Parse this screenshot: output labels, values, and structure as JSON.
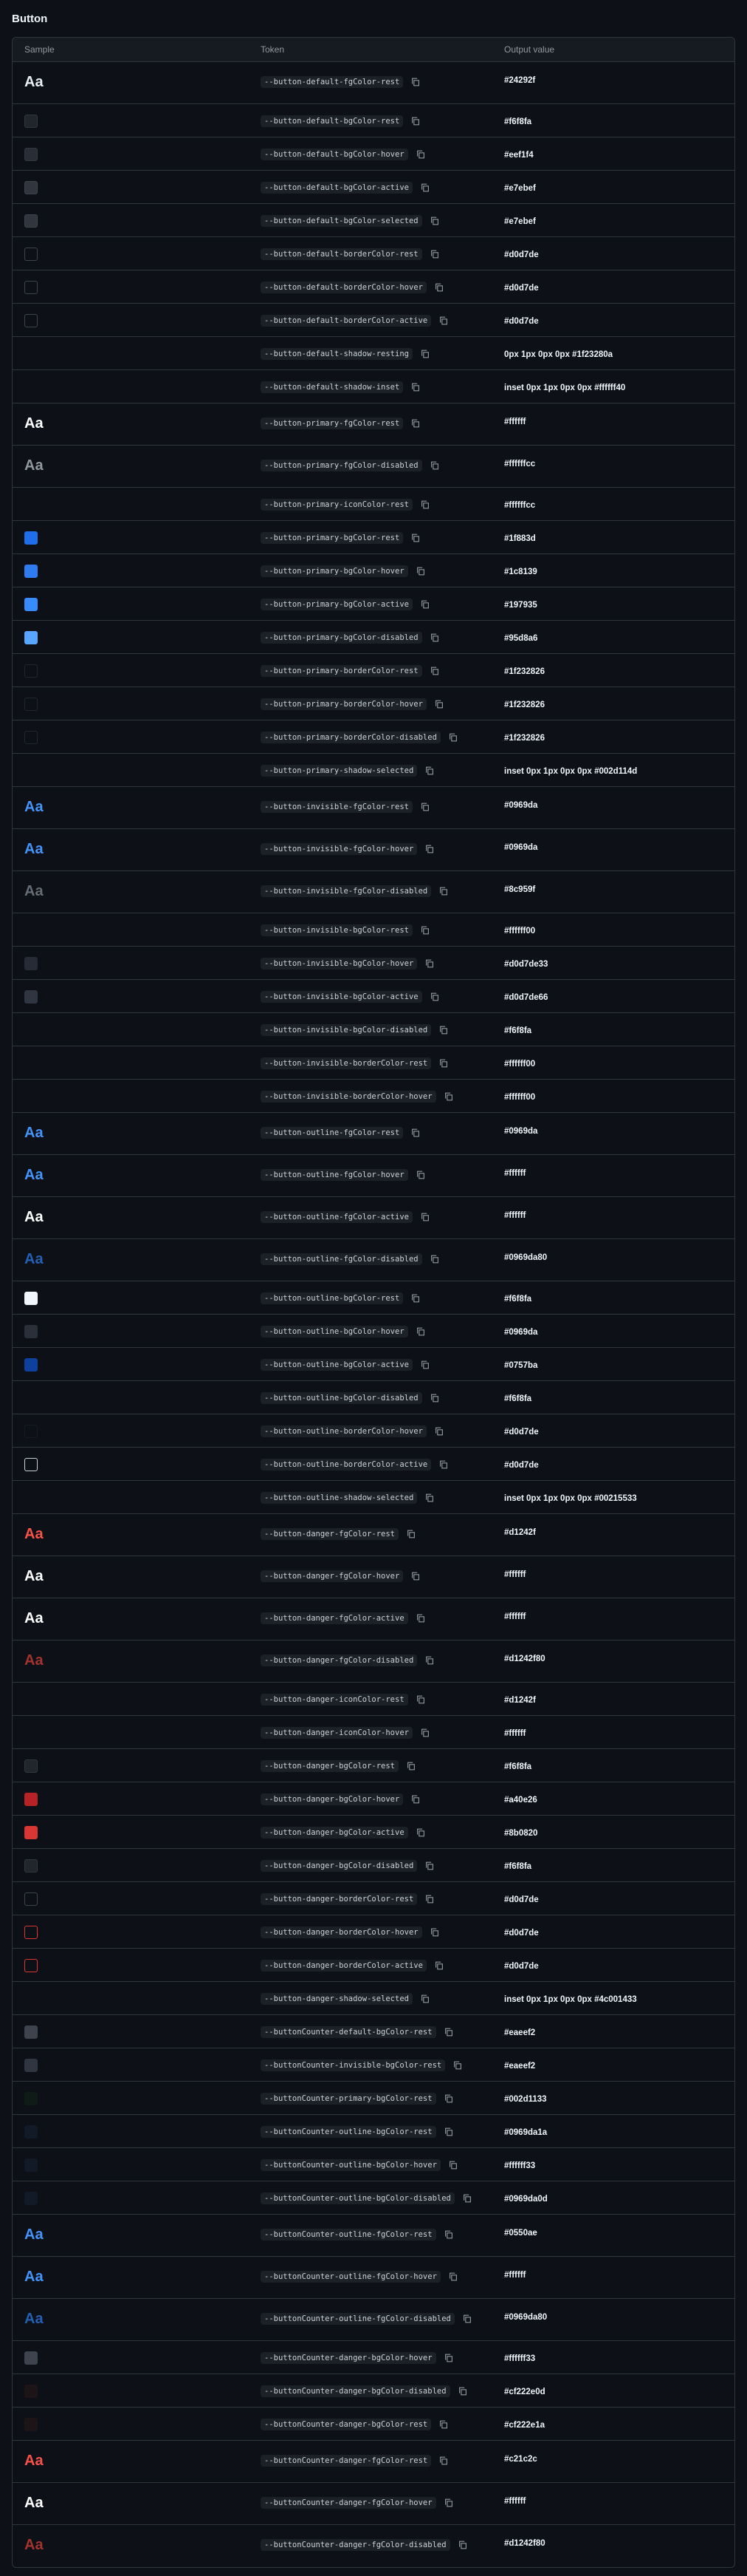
{
  "page": {
    "title": "Button"
  },
  "table": {
    "headers": {
      "sample": "Sample",
      "token": "Token",
      "output": "Output value"
    },
    "rows": [
      {
        "kind": "text",
        "color": "#e6edf3",
        "sample": "Aa",
        "token": "--button-default-fgColor-rest",
        "value": "#24292f"
      },
      {
        "kind": "swatch",
        "fill": "#21262d",
        "border": "#30363d",
        "token": "--button-default-bgColor-rest",
        "value": "#f6f8fa"
      },
      {
        "kind": "swatch",
        "fill": "#292e36",
        "border": "#30363d",
        "token": "--button-default-bgColor-hover",
        "value": "#eef1f4"
      },
      {
        "kind": "swatch",
        "fill": "#31363e",
        "border": "#3d444d",
        "token": "--button-default-bgColor-active",
        "value": "#e7ebef"
      },
      {
        "kind": "swatch",
        "fill": "#31363e",
        "border": "#3d444d",
        "token": "--button-default-bgColor-selected",
        "value": "#e7ebef"
      },
      {
        "kind": "swatch",
        "fill": "transparent",
        "border": "#3d444d",
        "token": "--button-default-borderColor-rest",
        "value": "#d0d7de"
      },
      {
        "kind": "swatch",
        "fill": "transparent",
        "border": "#3d444d",
        "token": "--button-default-borderColor-hover",
        "value": "#d0d7de"
      },
      {
        "kind": "swatch",
        "fill": "transparent",
        "border": "#3d444d",
        "token": "--button-default-borderColor-active",
        "value": "#d0d7de"
      },
      {
        "kind": "none",
        "token": "--button-default-shadow-resting",
        "value": "0px 1px 0px 0px #1f23280a"
      },
      {
        "kind": "none",
        "token": "--button-default-shadow-inset",
        "value": "inset 0px 1px 0px 0px #ffffff40"
      },
      {
        "kind": "text",
        "color": "#ffffff",
        "sample": "Aa",
        "token": "--button-primary-fgColor-rest",
        "value": "#ffffff"
      },
      {
        "kind": "text",
        "color": "#9198a1",
        "sample": "Aa",
        "token": "--button-primary-fgColor-disabled",
        "value": "#ffffffcc"
      },
      {
        "kind": "none",
        "token": "--button-primary-iconColor-rest",
        "value": "#ffffffcc"
      },
      {
        "kind": "swatch",
        "fill": "#1f6feb",
        "border": "#1f6feb",
        "token": "--button-primary-bgColor-rest",
        "value": "#1f883d"
      },
      {
        "kind": "swatch",
        "fill": "#2f7cf0",
        "border": "#2f7cf0",
        "token": "--button-primary-bgColor-hover",
        "value": "#1c8139"
      },
      {
        "kind": "swatch",
        "fill": "#388bfd",
        "border": "#388bfd",
        "token": "--button-primary-bgColor-active",
        "value": "#197935"
      },
      {
        "kind": "swatch",
        "fill": "#58a6ff",
        "border": "#58a6ff",
        "token": "--button-primary-bgColor-disabled",
        "value": "#95d8a6"
      },
      {
        "kind": "swatch",
        "fill": "transparent",
        "border": "#21262d",
        "token": "--button-primary-borderColor-rest",
        "value": "#1f232826"
      },
      {
        "kind": "swatch",
        "fill": "transparent",
        "border": "#21262d",
        "token": "--button-primary-borderColor-hover",
        "value": "#1f232826"
      },
      {
        "kind": "swatch",
        "fill": "transparent",
        "border": "#21262d",
        "token": "--button-primary-borderColor-disabled",
        "value": "#1f232826"
      },
      {
        "kind": "none",
        "token": "--button-primary-shadow-selected",
        "value": "inset 0px 1px 0px 0px #002d114d"
      },
      {
        "kind": "text",
        "color": "#4493f8",
        "sample": "Aa",
        "token": "--button-invisible-fgColor-rest",
        "value": "#0969da"
      },
      {
        "kind": "text",
        "color": "#4493f8",
        "sample": "Aa",
        "token": "--button-invisible-fgColor-hover",
        "value": "#0969da"
      },
      {
        "kind": "text",
        "color": "#656c76",
        "sample": "Aa",
        "token": "--button-invisible-fgColor-disabled",
        "value": "#8c959f"
      },
      {
        "kind": "none",
        "token": "--button-invisible-bgColor-rest",
        "value": "#ffffff00"
      },
      {
        "kind": "swatch",
        "fill": "#262c36",
        "border": "#262c36",
        "token": "--button-invisible-bgColor-hover",
        "value": "#d0d7de33"
      },
      {
        "kind": "swatch",
        "fill": "#2f3541",
        "border": "#2f3541",
        "token": "--button-invisible-bgColor-active",
        "value": "#d0d7de66"
      },
      {
        "kind": "none",
        "token": "--button-invisible-bgColor-disabled",
        "value": "#f6f8fa"
      },
      {
        "kind": "none",
        "token": "--button-invisible-borderColor-rest",
        "value": "#ffffff00"
      },
      {
        "kind": "none",
        "token": "--button-invisible-borderColor-hover",
        "value": "#ffffff00"
      },
      {
        "kind": "text",
        "color": "#4493f8",
        "sample": "Aa",
        "token": "--button-outline-fgColor-rest",
        "value": "#0969da"
      },
      {
        "kind": "text",
        "color": "#4493f8",
        "sample": "Aa",
        "token": "--button-outline-fgColor-hover",
        "value": "#ffffff"
      },
      {
        "kind": "text",
        "color": "#ffffff",
        "sample": "Aa",
        "token": "--button-outline-fgColor-active",
        "value": "#ffffff"
      },
      {
        "kind": "text",
        "color": "#2360b5",
        "sample": "Aa",
        "token": "--button-outline-fgColor-disabled",
        "value": "#0969da80"
      },
      {
        "kind": "swatch",
        "fill": "#f0f6fc",
        "border": "#f0f6fc",
        "token": "--button-outline-bgColor-rest",
        "value": "#f6f8fa"
      },
      {
        "kind": "swatch",
        "fill": "#2a303a",
        "border": "#2a303a",
        "token": "--button-outline-bgColor-hover",
        "value": "#0969da"
      },
      {
        "kind": "swatch",
        "fill": "#0d419d",
        "border": "#0d419d",
        "token": "--button-outline-bgColor-active",
        "value": "#0757ba"
      },
      {
        "kind": "none",
        "token": "--button-outline-bgColor-disabled",
        "value": "#f6f8fa"
      },
      {
        "kind": "swatch",
        "fill": "transparent",
        "border": "#161b22",
        "token": "--button-outline-borderColor-hover",
        "value": "#d0d7de"
      },
      {
        "kind": "swatch",
        "fill": "transparent",
        "border": "#c9d1d9",
        "token": "--button-outline-borderColor-active",
        "value": "#d0d7de"
      },
      {
        "kind": "none",
        "token": "--button-outline-shadow-selected",
        "value": "inset 0px 1px 0px 0px #00215533"
      },
      {
        "kind": "text",
        "color": "#f85149",
        "sample": "Aa",
        "token": "--button-danger-fgColor-rest",
        "value": "#d1242f"
      },
      {
        "kind": "text",
        "color": "#ffffff",
        "sample": "Aa",
        "token": "--button-danger-fgColor-hover",
        "value": "#ffffff"
      },
      {
        "kind": "text",
        "color": "#ffffff",
        "sample": "Aa",
        "token": "--button-danger-fgColor-active",
        "value": "#ffffff"
      },
      {
        "kind": "text",
        "color": "#a3332e",
        "sample": "Aa",
        "token": "--button-danger-fgColor-disabled",
        "value": "#d1242f80"
      },
      {
        "kind": "none",
        "token": "--button-danger-iconColor-rest",
        "value": "#d1242f"
      },
      {
        "kind": "none",
        "token": "--button-danger-iconColor-hover",
        "value": "#ffffff"
      },
      {
        "kind": "swatch",
        "fill": "#21262d",
        "border": "#30363d",
        "token": "--button-danger-bgColor-rest",
        "value": "#f6f8fa"
      },
      {
        "kind": "swatch",
        "fill": "#b62324",
        "border": "#b62324",
        "token": "--button-danger-bgColor-hover",
        "value": "#a40e26"
      },
      {
        "kind": "swatch",
        "fill": "#da3633",
        "border": "#da3633",
        "token": "--button-danger-bgColor-active",
        "value": "#8b0820"
      },
      {
        "kind": "swatch",
        "fill": "#21262d",
        "border": "#30363d",
        "token": "--button-danger-bgColor-disabled",
        "value": "#f6f8fa"
      },
      {
        "kind": "swatch",
        "fill": "transparent",
        "border": "#3d444d",
        "token": "--button-danger-borderColor-rest",
        "value": "#d0d7de"
      },
      {
        "kind": "swatch",
        "fill": "transparent",
        "border": "#da3633",
        "token": "--button-danger-borderColor-hover",
        "value": "#d0d7de"
      },
      {
        "kind": "swatch",
        "fill": "transparent",
        "border": "#da3633",
        "token": "--button-danger-borderColor-active",
        "value": "#d0d7de"
      },
      {
        "kind": "none",
        "token": "--button-danger-shadow-selected",
        "value": "inset 0px 1px 0px 0px #4c001433"
      },
      {
        "kind": "swatch",
        "fill": "#3d444d",
        "border": "#3d444d",
        "token": "--buttonCounter-default-bgColor-rest",
        "value": "#eaeef2"
      },
      {
        "kind": "swatch",
        "fill": "#2f3541",
        "border": "#2f3541",
        "token": "--buttonCounter-invisible-bgColor-rest",
        "value": "#eaeef2"
      },
      {
        "kind": "swatch",
        "fill": "#0f1b16",
        "border": "#0f1b16",
        "token": "--buttonCounter-primary-bgColor-rest",
        "value": "#002d1133"
      },
      {
        "kind": "swatch",
        "fill": "#111a26",
        "border": "#111a26",
        "token": "--buttonCounter-outline-bgColor-rest",
        "value": "#0969da1a"
      },
      {
        "kind": "swatch",
        "fill": "#111a26",
        "border": "#111a26",
        "token": "--buttonCounter-outline-bgColor-hover",
        "value": "#ffffff33"
      },
      {
        "kind": "swatch",
        "fill": "#111a26",
        "border": "#111a26",
        "token": "--buttonCounter-outline-bgColor-disabled",
        "value": "#0969da0d"
      },
      {
        "kind": "text",
        "color": "#4493f8",
        "sample": "Aa",
        "token": "--buttonCounter-outline-fgColor-rest",
        "value": "#0550ae"
      },
      {
        "kind": "text",
        "color": "#4493f8",
        "sample": "Aa",
        "token": "--buttonCounter-outline-fgColor-hover",
        "value": "#ffffff"
      },
      {
        "kind": "text",
        "color": "#2360b5",
        "sample": "Aa",
        "token": "--buttonCounter-outline-fgColor-disabled",
        "value": "#0969da80"
      },
      {
        "kind": "swatch",
        "fill": "#3d444d",
        "border": "#3d444d",
        "token": "--buttonCounter-danger-bgColor-hover",
        "value": "#ffffff33"
      },
      {
        "kind": "swatch",
        "fill": "#1d1417",
        "border": "#1d1417",
        "token": "--buttonCounter-danger-bgColor-disabled",
        "value": "#cf222e0d"
      },
      {
        "kind": "swatch",
        "fill": "#1d1417",
        "border": "#1d1417",
        "token": "--buttonCounter-danger-bgColor-rest",
        "value": "#cf222e1a"
      },
      {
        "kind": "text",
        "color": "#f85149",
        "sample": "Aa",
        "token": "--buttonCounter-danger-fgColor-rest",
        "value": "#c21c2c"
      },
      {
        "kind": "text",
        "color": "#ffffff",
        "sample": "Aa",
        "token": "--buttonCounter-danger-fgColor-hover",
        "value": "#ffffff"
      },
      {
        "kind": "text",
        "color": "#a3332e",
        "sample": "Aa",
        "token": "--buttonCounter-danger-fgColor-disabled",
        "value": "#d1242f80"
      }
    ]
  },
  "icons": {
    "copy": "copy-icon"
  }
}
